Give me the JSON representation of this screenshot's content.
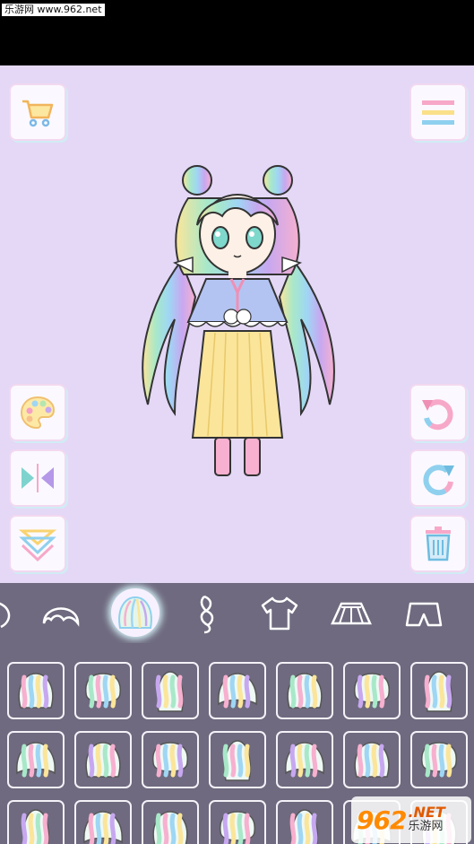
{
  "status_bar": {
    "watermark_text": "乐游网 www.962.net"
  },
  "toolbar_left": [
    {
      "name": "shop-cart-icon"
    },
    {
      "name": "color-palette-icon"
    },
    {
      "name": "flip-horizontal-icon"
    },
    {
      "name": "layer-down-icon"
    }
  ],
  "toolbar_right": [
    {
      "name": "menu-icon"
    },
    {
      "name": "undo-icon"
    },
    {
      "name": "redo-icon"
    },
    {
      "name": "trash-icon"
    }
  ],
  "categories": [
    {
      "name": "face-category-icon"
    },
    {
      "name": "bangs-category-icon"
    },
    {
      "name": "hair-category-icon",
      "selected": true
    },
    {
      "name": "side-hair-category-icon"
    },
    {
      "name": "top-category-icon"
    },
    {
      "name": "skirt-category-icon"
    },
    {
      "name": "shorts-category-icon"
    }
  ],
  "colors": {
    "canvas_bg": "#e4d8f6",
    "panel_bg": "#6f6a7f",
    "accent_pink": "#f7a8c8",
    "accent_blue": "#8fd0ee",
    "accent_yellow": "#fbe79a"
  },
  "corner_watermark": {
    "number": "962",
    "net": ".NET",
    "site": "乐游网"
  }
}
